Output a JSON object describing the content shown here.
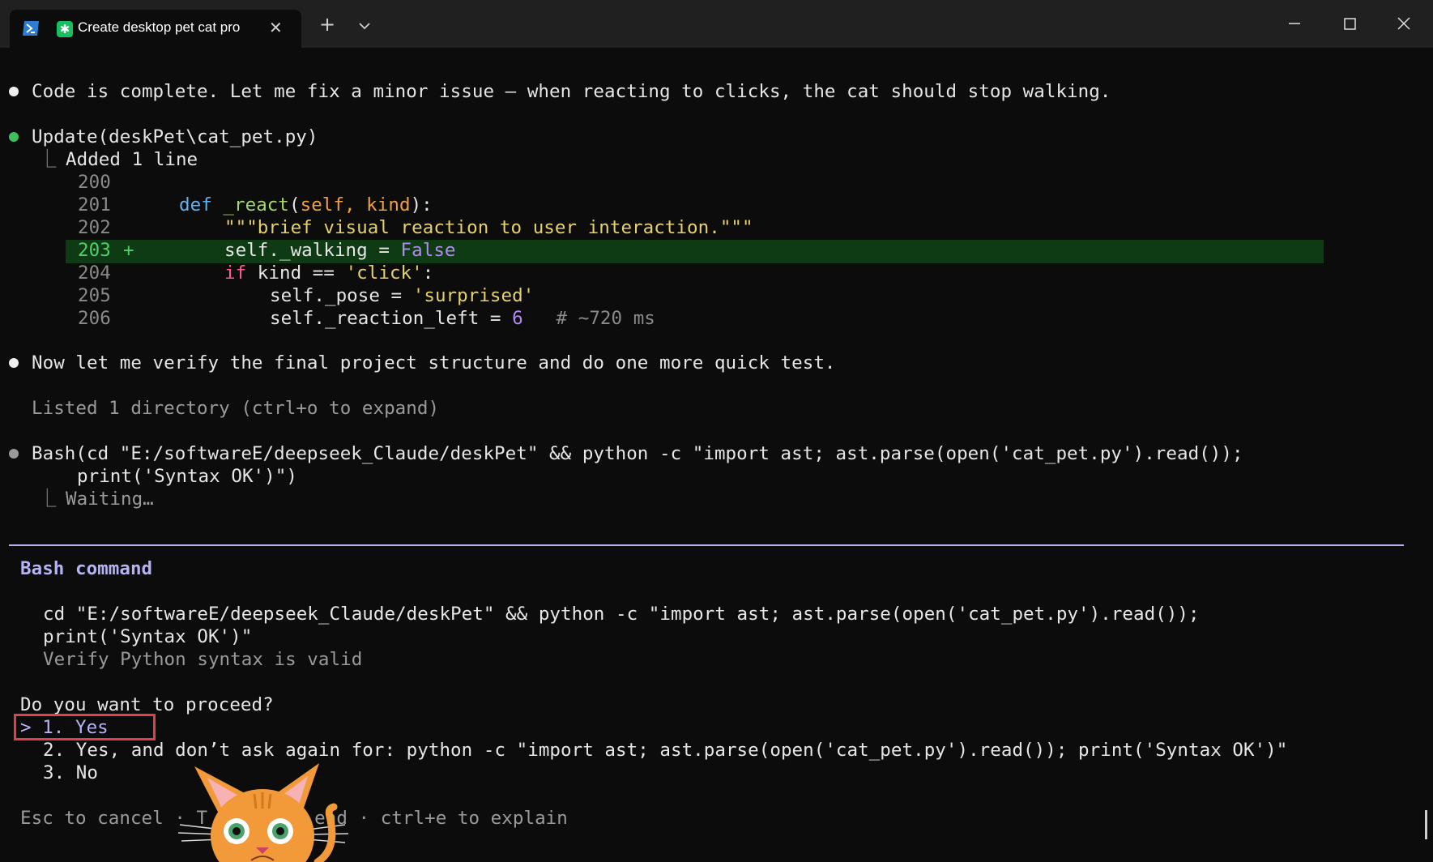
{
  "window": {
    "tab_title": "Create desktop pet cat pro",
    "tab_close": "✕",
    "new_tab": "+",
    "accent_colors": {
      "tab_icon": "#16c060",
      "powershell_icon": "#2d7dd2",
      "selection": "#b6b2f4",
      "highlight_box": "#e0404a",
      "diff_added_bg": "#0e3a14"
    }
  },
  "terminal": {
    "msg1": "Code is complete. Let me fix a minor issue – when reacting to clicks, the cat should stop walking.",
    "update": {
      "tool": "Update",
      "arg": "(deskPet\\cat_pet.py)",
      "branch": "⎿",
      "summary": "Added 1 line"
    },
    "diff": {
      "n200": "200",
      "n201": "201",
      "n202": "202",
      "n203": "203",
      "plus": "+",
      "n204": "204",
      "n205": "205",
      "n206": "206",
      "l201_def": "def",
      "l201_fn": "_react",
      "l201_open": "(",
      "l201_args": "self, kind",
      "l201_close": "):",
      "l202": "\"\"\"brief visual reaction to user interaction.\"\"\"",
      "l203_a": "self._walking = ",
      "l203_b": "False",
      "l204_if": "if",
      "l204_mid": " kind == ",
      "l204_str": "'click'",
      "l204_end": ":",
      "l205_a": "self._pose = ",
      "l205_str": "'surprised'",
      "l206_a": "self._reaction_left = ",
      "l206_num": "6",
      "l206_comment": "# ~720 ms"
    },
    "msg2": "Now let me verify the final project structure and do one more quick test.",
    "listed": "Listed 1 directory (ctrl+o to expand)",
    "bash": {
      "tool": "Bash",
      "arg1": "(cd \"E:/softwareE/deepseek_Claude/deskPet\" && python -c \"import ast; ast.parse(open('cat_pet.py').read());",
      "arg2": "print('Syntax OK')\")",
      "branch": "⎿",
      "status": "Waiting…"
    }
  },
  "prompt": {
    "title": "Bash command",
    "cmd1": "cd \"E:/softwareE/deepseek_Claude/deskPet\" && python -c \"import ast; ast.parse(open('cat_pet.py').read());",
    "cmd2": "print('Syntax OK')\"",
    "description": "Verify Python syntax is valid",
    "question": "Do you want to proceed?",
    "options": [
      "> 1. Yes",
      "2. Yes, and don’t ask again for: python -c \"import ast; ast.parse(open('cat_pet.py').read()); print('Syntax OK')\"",
      "3. No"
    ],
    "footer_a": "Esc to cancel · T",
    "footer_b": "end · ctrl+e to explain"
  },
  "overlay": {
    "pet": "cat-desktop-pet"
  }
}
